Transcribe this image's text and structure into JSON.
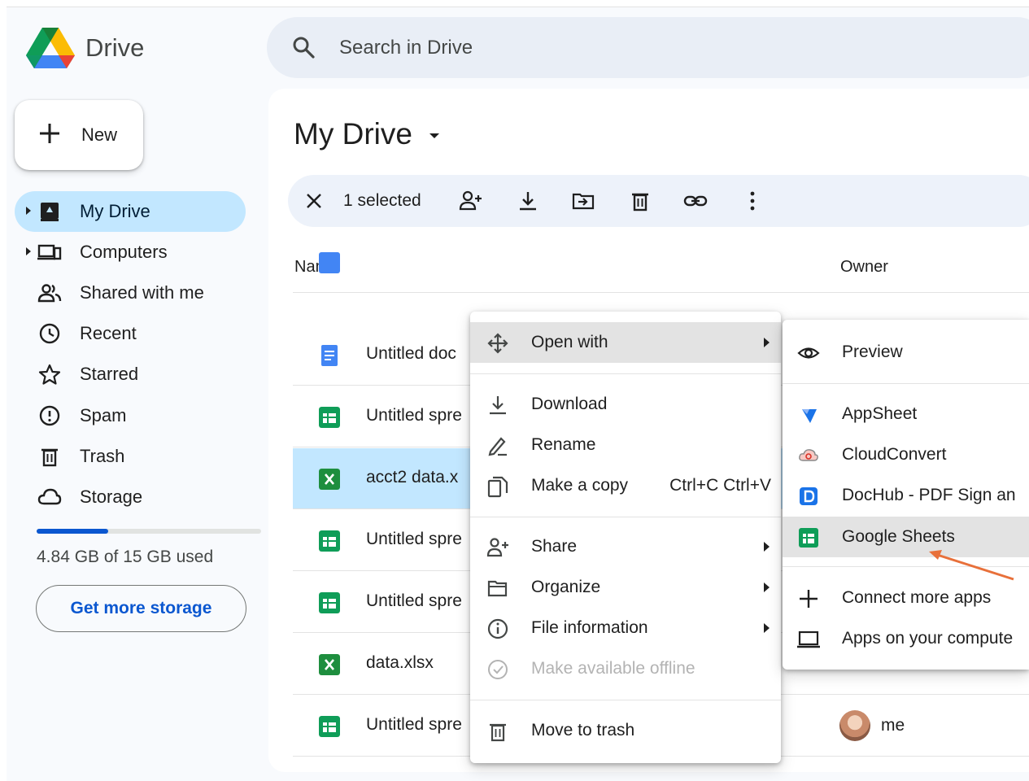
{
  "header": {
    "app_name": "Drive",
    "search_placeholder": "Search in Drive"
  },
  "sidebar": {
    "new_label": "New",
    "items": [
      {
        "label": "My Drive",
        "icon": "my-drive-icon",
        "active": true,
        "expandable": true
      },
      {
        "label": "Computers",
        "icon": "computers-icon",
        "expandable": true
      },
      {
        "label": "Shared with me",
        "icon": "shared-icon"
      },
      {
        "label": "Recent",
        "icon": "clock-icon"
      },
      {
        "label": "Starred",
        "icon": "star-icon"
      },
      {
        "label": "Spam",
        "icon": "spam-icon"
      },
      {
        "label": "Trash",
        "icon": "trash-icon"
      },
      {
        "label": "Storage",
        "icon": "cloud-icon"
      }
    ],
    "storage_used_fraction": 0.32,
    "storage_text": "4.84 GB of 15 GB used",
    "get_storage_label": "Get more storage"
  },
  "main": {
    "title": "My Drive",
    "selection": {
      "count_text": "1 selected"
    },
    "columns": {
      "name": "Name",
      "owner": "Owner"
    },
    "files": [
      {
        "name": "Untitled doc",
        "type": "doc"
      },
      {
        "name": "Untitled spre",
        "type": "sheet"
      },
      {
        "name": "acct2 data.x",
        "type": "excel",
        "selected": true
      },
      {
        "name": "Untitled spre",
        "type": "sheet"
      },
      {
        "name": "Untitled spre",
        "type": "sheet"
      },
      {
        "name": "data.xlsx",
        "type": "excel"
      },
      {
        "name": "Untitled spre",
        "type": "sheet",
        "owner": "me"
      }
    ]
  },
  "context_menu": {
    "open_with": "Open with",
    "download": "Download",
    "rename": "Rename",
    "make_copy": "Make a copy",
    "make_copy_shortcut": "Ctrl+C Ctrl+V",
    "share": "Share",
    "organize": "Organize",
    "file_information": "File information",
    "make_offline": "Make available offline",
    "move_to_trash": "Move to trash"
  },
  "open_with_menu": {
    "preview": "Preview",
    "appsheet": "AppSheet",
    "cloudconvert": "CloudConvert",
    "dochub": "DocHub - PDF Sign an",
    "google_sheets": "Google Sheets",
    "connect_more": "Connect more apps",
    "apps_on_computer": "Apps on your compute"
  },
  "colors": {
    "accent": "#0b57d0",
    "selected": "#c2e7ff",
    "sheets_green": "#0f9d58",
    "docs_blue": "#4285f4",
    "excel_green": "#1e8e3e",
    "annotation": "#e8703a"
  }
}
